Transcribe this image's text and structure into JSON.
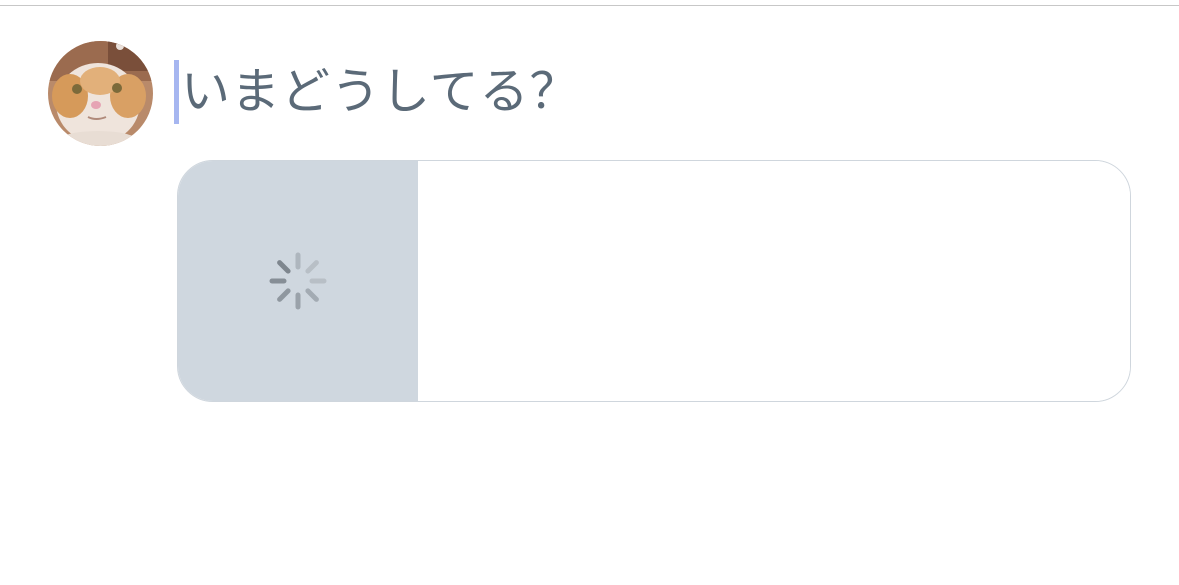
{
  "composer": {
    "placeholder": "いまどうしてる？",
    "avatar_icon": "user-avatar-cat",
    "caret_color": "#a6b6f0",
    "placeholder_color": "#5b6a78"
  },
  "link_card": {
    "state": "loading",
    "thumb_icon": "loading-spinner-icon",
    "thumb_color": "#cfd7df"
  }
}
